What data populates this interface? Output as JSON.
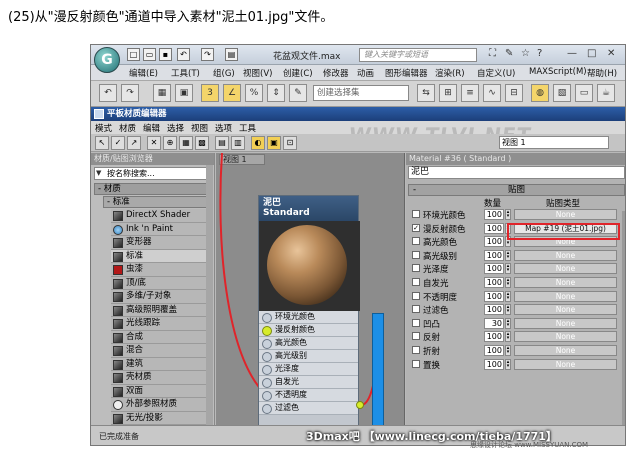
{
  "caption": "(25)从\"漫反射颜色\"通道中导入素材\"泥土01.jpg\"文件。",
  "app": {
    "logo": "G",
    "file_title": "花盆观文件.max",
    "search_placeholder": "键入关键字或短语",
    "menu": [
      "编辑(E)",
      "工具(T)",
      "组(G)",
      "视图(V)",
      "创建(C)",
      "修改器",
      "动画",
      "图形编辑器",
      "渲染(R)",
      "自定义(U)",
      "MAXScript(M)",
      "帮助(H)"
    ],
    "selection_set": "创建选择集"
  },
  "material_editor": {
    "title": "平板材质编辑器",
    "menu": [
      "模式",
      "材质",
      "编辑",
      "选择",
      "视图",
      "选项",
      "工具"
    ],
    "view_dropdown": "视图 1",
    "watermark": "WWW.TLVI.NET",
    "browser_title": "材质/贴图浏览器",
    "browser_search": "按名称搜索...",
    "group_label": "- 材质",
    "sub_group_label": "- 标准",
    "materials": [
      {
        "name": "DirectX Shader",
        "swatch": "dark"
      },
      {
        "name": "Ink 'n Paint",
        "swatch": "blue"
      },
      {
        "name": "变形器",
        "swatch": "dark"
      },
      {
        "name": "标准",
        "swatch": "dark"
      },
      {
        "name": "虫漆",
        "swatch": "red"
      },
      {
        "name": "顶/底",
        "swatch": "dark"
      },
      {
        "name": "多维/子对象",
        "swatch": "dark"
      },
      {
        "name": "高级照明覆盖",
        "swatch": "dark"
      },
      {
        "name": "光线跟踪",
        "swatch": "dark"
      },
      {
        "name": "合成",
        "swatch": "dark"
      },
      {
        "name": "混合",
        "swatch": "dark"
      },
      {
        "name": "建筑",
        "swatch": "dark"
      },
      {
        "name": "壳材质",
        "swatch": "dark"
      },
      {
        "name": "双面",
        "swatch": "dark"
      },
      {
        "name": "外部参照材质",
        "swatch": "white"
      },
      {
        "name": "无光/投影",
        "swatch": "dark"
      }
    ],
    "view_tab": "视图 1",
    "node": {
      "title": "泥巴",
      "type": "Standard",
      "slots": [
        "环境光颜色",
        "漫反射颜色",
        "高光颜色",
        "高光级别",
        "光泽度",
        "自发光",
        "不透明度",
        "过滤色"
      ]
    },
    "params_title": "Material #36 ( Standard )",
    "material_name": "泥巴",
    "maps_rollout": "贴图",
    "col_amount": "数量",
    "col_map_type": "贴图类型",
    "maps": [
      {
        "label": "环境光颜色",
        "checked": false,
        "amount": "100",
        "map": "None"
      },
      {
        "label": "漫反射颜色",
        "checked": true,
        "amount": "100",
        "map": "Map #19 (泥土01.jpg)"
      },
      {
        "label": "高光颜色",
        "checked": false,
        "amount": "100",
        "map": "None"
      },
      {
        "label": "高光级别",
        "checked": false,
        "amount": "100",
        "map": "None"
      },
      {
        "label": "光泽度",
        "checked": false,
        "amount": "100",
        "map": "None"
      },
      {
        "label": "自发光",
        "checked": false,
        "amount": "100",
        "map": "None"
      },
      {
        "label": "不透明度",
        "checked": false,
        "amount": "100",
        "map": "None"
      },
      {
        "label": "过滤色",
        "checked": false,
        "amount": "100",
        "map": "None"
      },
      {
        "label": "凹凸",
        "checked": false,
        "amount": "30",
        "map": "None"
      },
      {
        "label": "反射",
        "checked": false,
        "amount": "100",
        "map": "None"
      },
      {
        "label": "折射",
        "checked": false,
        "amount": "100",
        "map": "None"
      },
      {
        "label": "置换",
        "checked": false,
        "amount": "100",
        "map": "None"
      }
    ],
    "status": "已完成准备"
  },
  "overlay": "3Dmax吧 【www.linecg.com/tieba/1771】",
  "corner_credit": "思缘设计论坛 www.MISSYUAN.COM",
  "colors": {
    "highlight_box": "#e0242a",
    "node_header": "#3f5f86",
    "title_bar": "#2d5ea8"
  }
}
